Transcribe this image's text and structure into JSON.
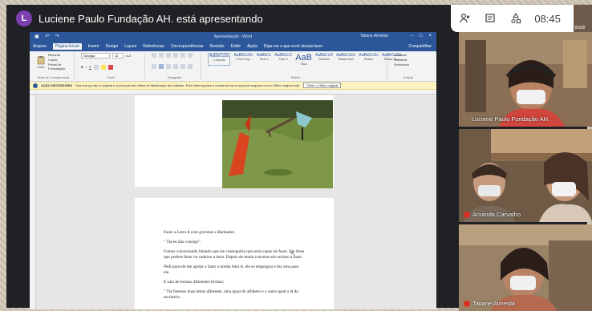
{
  "meet": {
    "presenter_initial": "L",
    "presenting_text": "Luciene Paulo Fundação AH. está apresentando",
    "time": "08:45",
    "self_label": "Você",
    "icons": [
      "people-icon",
      "chat-icon",
      "activities-icon"
    ]
  },
  "word": {
    "title": "Apresentação - Word",
    "user": "Tatiane Almeida",
    "tabs": [
      "Arquivo",
      "Página Inicial",
      "Inserir",
      "Design",
      "Layout",
      "Referências",
      "Correspondências",
      "Revisão",
      "Exibir",
      "Ajuda",
      "Diga-me o que você deseja fazer"
    ],
    "share_label": "Compartilhar",
    "clipboard": {
      "paste": "Colar",
      "cut": "Recortar",
      "copy": "Copiar",
      "painter": "Pincel de Formatação",
      "group": "Área de Transferência"
    },
    "font": {
      "name": "Georgia",
      "size": "12",
      "group": "Fonte"
    },
    "paragraph_group": "Parágrafo",
    "styles": [
      {
        "sample": "AaBbCcDc",
        "name": "1 Normal"
      },
      {
        "sample": "AaBbCcDc",
        "name": "1 Sem Esp..."
      },
      {
        "sample": "AaBbCc",
        "name": "Título 1"
      },
      {
        "sample": "AaBbCcC",
        "name": "Título 2"
      },
      {
        "sample": "AaB",
        "name": "Título"
      },
      {
        "sample": "AaBbCcD",
        "name": "Subtítulo"
      },
      {
        "sample": "AaBbCcDc",
        "name": "Ênfase Sutil"
      },
      {
        "sample": "AaBbCcDc",
        "name": "Ênfase"
      },
      {
        "sample": "AaBbCcDc",
        "name": "Ênfase Int..."
      }
    ],
    "styles_group": "Estilos",
    "editing": {
      "find": "Localizar",
      "replace": "Substituir",
      "select": "Selecionar",
      "group": "Edição"
    },
    "message": {
      "label": "AÇÃO NECESSÁRIA",
      "text": "Sua licença não é original e você pode ser vítima de falsificação de software. Evite interrupções e mantenha seus arquivos seguros com o Office original hoje.",
      "button": "Obter o Office original"
    }
  },
  "document": {
    "paragraphs": [
      "Fazer a Letra A com gravetos e Barbantes",
      "\" Tia eu não consigo\".",
      "Fomos conversando falando que ele conseguiria que seria capaz de fazer. Ele disse que prefere fazer no caderno a letra. Depois de muita conversa ele aceitou a fazer.",
      "Pedi para ele me ajudar a fazer a minha letra A. ele se empolgou e fez uma para ele.",
      "E saiu de formas diferentes formas;",
      "\" Tia fizemos duas letras diferente, uma igual do alfabeto e a outra igual a lá do escritório."
    ]
  },
  "participants": [
    {
      "name": "Luciene Paulo Fundação AH.",
      "muted": false
    },
    {
      "name": "Amanda Carvalho",
      "muted": true
    },
    {
      "name": "Tatiane Almeida",
      "muted": true
    }
  ]
}
